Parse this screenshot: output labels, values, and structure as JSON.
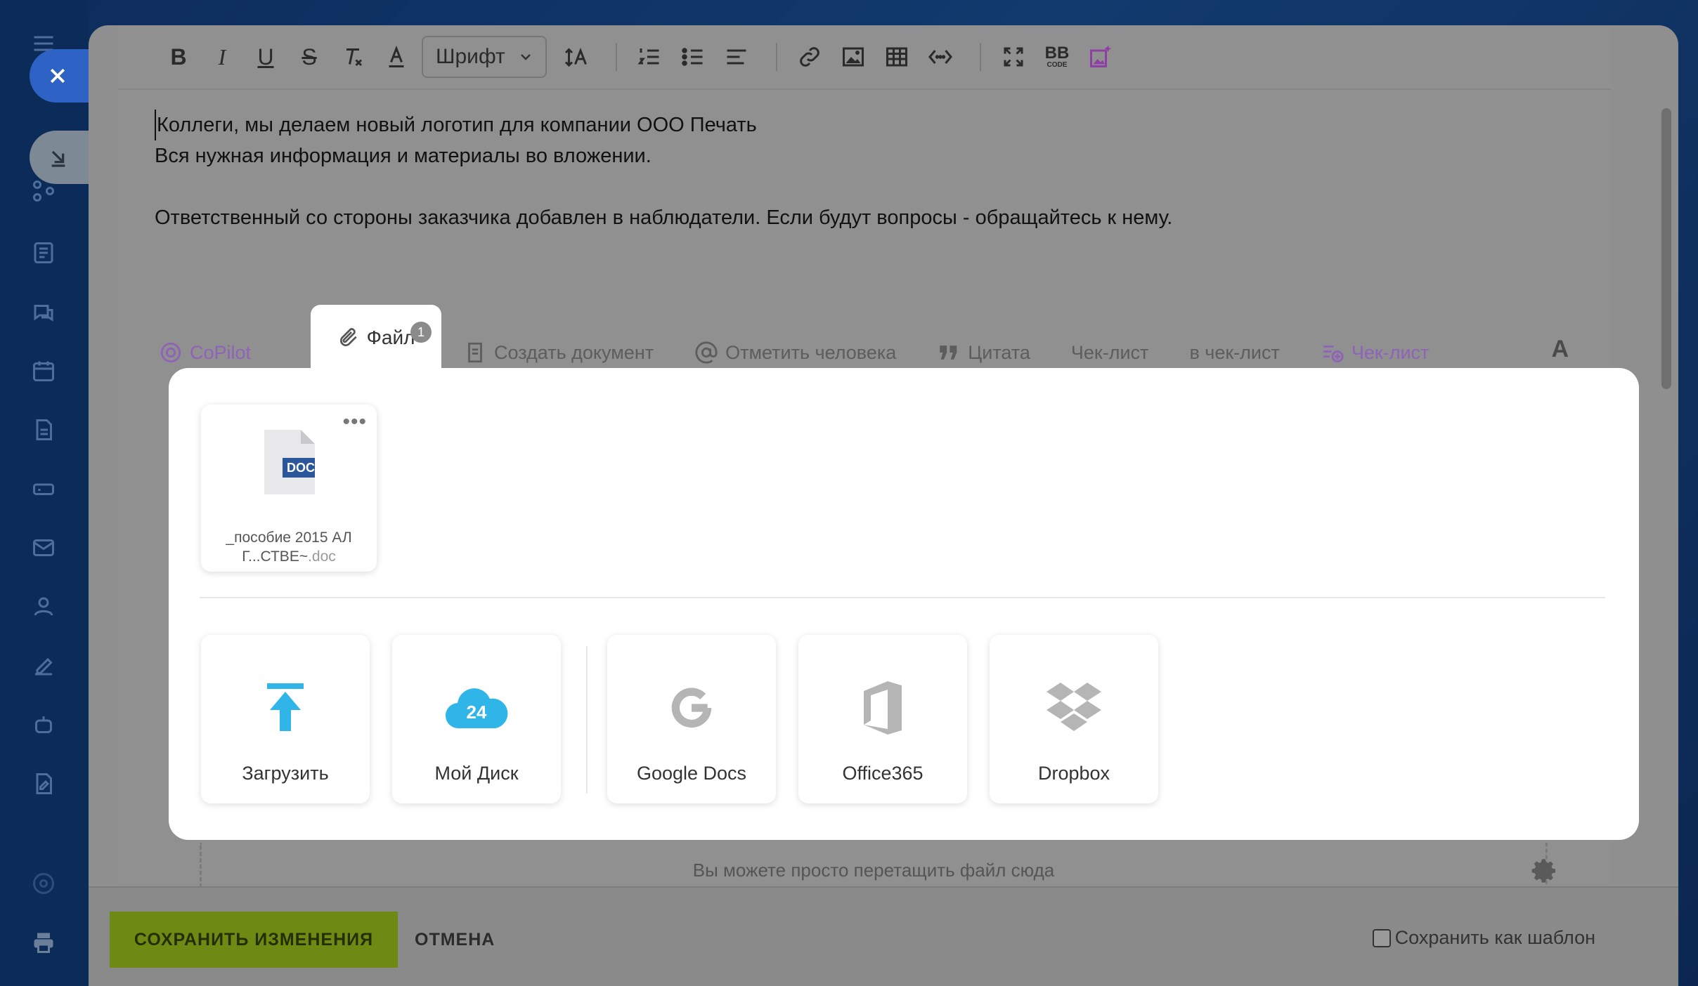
{
  "toolbar": {
    "font_select_label": "Шрифт",
    "bbcode_label": "BB",
    "bbcode_sub": "CODE"
  },
  "editor": {
    "lines": [
      "Коллеги, мы делаем новый логотип для компании ООО Печать",
      "Вся нужная информация и материалы во вложении.",
      "",
      "Ответственный со стороны заказчика добавлен в наблюдатели. Если будут вопросы - обращайтесь к нему."
    ]
  },
  "insert_tabs": {
    "copilot": "CoPilot",
    "file": "Файл",
    "file_count": "1",
    "create_document": "Создать документ",
    "mention": "Отметить человека",
    "quote": "Цитата",
    "checklist": "Чек-лист",
    "to_checklist": "в чек-лист",
    "checklist_ai": "Чек-лист",
    "font_toggle": "A"
  },
  "files": {
    "attached": [
      {
        "name": "_пособие 2015 АЛ Г...СТВЕ~",
        "ext": ".doc",
        "badge": "DOC"
      }
    ],
    "sources": [
      {
        "label": "Загрузить",
        "icon": "upload-icon"
      },
      {
        "label": "Мой Диск",
        "icon": "bitrix24-cloud-icon",
        "icon_text": "24"
      },
      {
        "label": "Google Docs",
        "icon": "google-icon"
      },
      {
        "label": "Office365",
        "icon": "office365-icon"
      },
      {
        "label": "Dropbox",
        "icon": "dropbox-icon"
      }
    ]
  },
  "dropzone": {
    "text": "Вы можете просто перетащить файл сюда"
  },
  "footer": {
    "save_label": "СОХРАНИТЬ ИЗМЕНЕНИЯ",
    "cancel_label": "ОТМЕНА",
    "save_template_label": "Сохранить как шаблон"
  },
  "colors": {
    "save_button": "#6f8a14",
    "accent_blue": "#2fb5e8",
    "purple": "#8e63b8",
    "doc_badge": "#2b579a"
  }
}
